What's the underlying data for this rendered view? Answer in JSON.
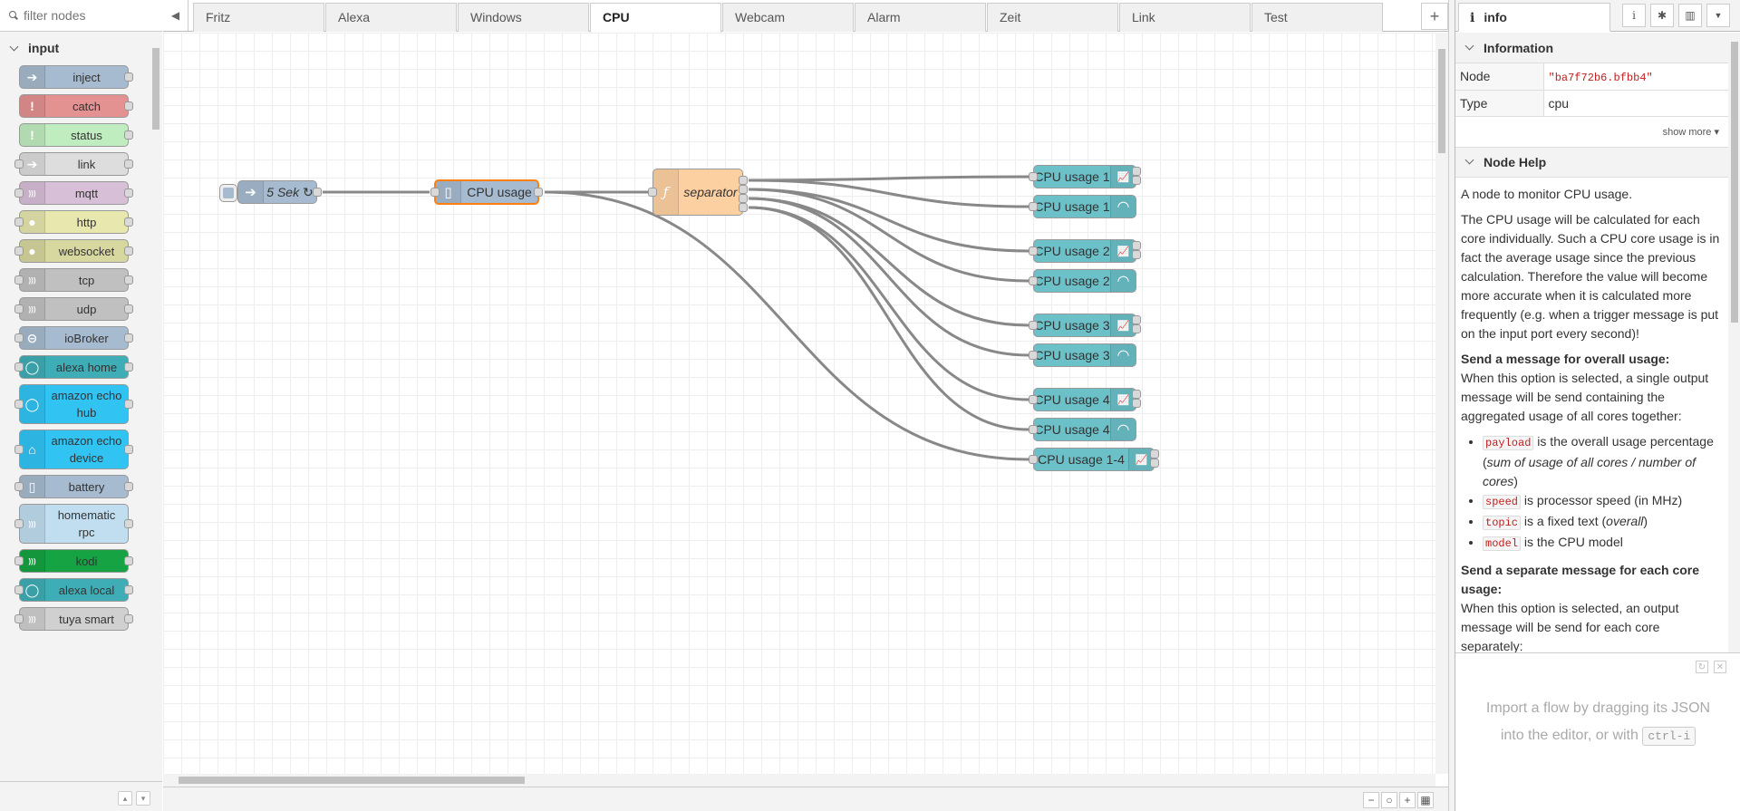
{
  "palette": {
    "search_placeholder": "filter nodes",
    "category": "input",
    "nodes": [
      {
        "label": "inject",
        "color": "#a6bbcf",
        "icon": "arrow-icon"
      },
      {
        "label": "catch",
        "color": "#e49191",
        "icon": "exclamation-icon"
      },
      {
        "label": "status",
        "color": "#c0edc0",
        "icon": "exclamation-icon"
      },
      {
        "label": "link",
        "color": "#dddddd",
        "icon": "arrow-icon"
      },
      {
        "label": "mqtt",
        "color": "#d8bfd8",
        "icon": "wave-icon"
      },
      {
        "label": "http",
        "color": "#e7e7ae",
        "icon": "globe-icon"
      },
      {
        "label": "websocket",
        "color": "#d7d7a0",
        "icon": "globe-icon"
      },
      {
        "label": "tcp",
        "color": "#c0c0c0",
        "icon": "wave-icon"
      },
      {
        "label": "udp",
        "color": "#c0c0c0",
        "icon": "wave-icon"
      },
      {
        "label": "ioBroker",
        "color": "#a6bbcf",
        "icon": "iobroker-icon"
      },
      {
        "label": "alexa home",
        "color": "#3fadb5",
        "icon": "ring-icon"
      },
      {
        "label": "amazon echo hub",
        "color": "#31c4f3",
        "icon": "ring-icon"
      },
      {
        "label": "amazon echo device",
        "color": "#31c4f3",
        "icon": "wifi-icon"
      },
      {
        "label": "battery",
        "color": "#a6bbcf",
        "icon": "battery-icon"
      },
      {
        "label": "homematic rpc",
        "color": "#c0def0",
        "icon": "wave-icon"
      },
      {
        "label": "kodi",
        "color": "#16a343",
        "icon": "wave-icon"
      },
      {
        "label": "alexa local",
        "color": "#3fadb5",
        "icon": "ring-icon"
      },
      {
        "label": "tuya smart",
        "color": "#d0d0d0",
        "icon": "wave-icon"
      }
    ]
  },
  "tabs": [
    {
      "label": "Fritz",
      "active": false
    },
    {
      "label": "Alexa",
      "active": false
    },
    {
      "label": "Windows",
      "active": false
    },
    {
      "label": "CPU",
      "active": true
    },
    {
      "label": "Webcam",
      "active": false
    },
    {
      "label": "Alarm",
      "active": false
    },
    {
      "label": "Zeit",
      "active": false
    },
    {
      "label": "Link",
      "active": false
    },
    {
      "label": "Test",
      "active": false
    }
  ],
  "flow": {
    "inject_label": "5 Sek ↻",
    "cpu_label": "CPU usage",
    "separator_label": "separator",
    "outputs": [
      {
        "label": "CPU usage 1",
        "kind": "chart"
      },
      {
        "label": "CPU usage 1",
        "kind": "gauge"
      },
      {
        "label": "CPU usage 2",
        "kind": "chart"
      },
      {
        "label": "CPU usage 2",
        "kind": "gauge"
      },
      {
        "label": "CPU usage 3",
        "kind": "chart"
      },
      {
        "label": "CPU usage 3",
        "kind": "gauge"
      },
      {
        "label": "CPU usage 4",
        "kind": "chart"
      },
      {
        "label": "CPU usage 4",
        "kind": "gauge"
      },
      {
        "label": "CPU usage 1-4",
        "kind": "chart"
      }
    ]
  },
  "colors": {
    "inject": "#a6bbcf",
    "cpu": "#a6bbcf",
    "separator": "#fdd0a2",
    "dashboard": "#6cc0c8",
    "selected": "#ff7f0e",
    "wire": "#888888"
  },
  "sidebar": {
    "tab_label": "info",
    "info_header": "Information",
    "node_key": "Node",
    "node_value": "\"ba7f72b6.bfbb4\"",
    "type_key": "Type",
    "type_value": "cpu",
    "show_more": "show more ▾",
    "help_header": "Node Help",
    "help": {
      "p1": "A node to monitor CPU usage.",
      "p2": "The CPU usage will be calculated for each core individually. Such a CPU core usage is in fact the average usage since the previous calculation. Therefore the value will become more accurate when it is calculated more frequently (e.g. when a trigger message is put on the input port every second)!",
      "h1": "Send a message for overall usage:",
      "p3": "When this option is selected, a single output message will be send containing the aggregated usage of all cores together:",
      "li1_code": "payload",
      "li1_text": " is the overall usage percentage (",
      "li1_em": "sum of usage of all cores / number of cores",
      "li1_end": ")",
      "li2_code": "speed",
      "li2_text": " is processor speed (in MHz)",
      "li3_code": "topic",
      "li3_text": " is a fixed text (",
      "li3_em": "overall",
      "li3_end": ")",
      "li4_code": "model",
      "li4_text": " is the CPU model",
      "h2": "Send a separate message for each core usage:",
      "p4": "When this option is selected, an output message will be send for each core separately:"
    },
    "import_line1": "Import a flow by dragging its JSON",
    "import_line2": "into the editor, or with",
    "import_kbd": "ctrl-i"
  }
}
